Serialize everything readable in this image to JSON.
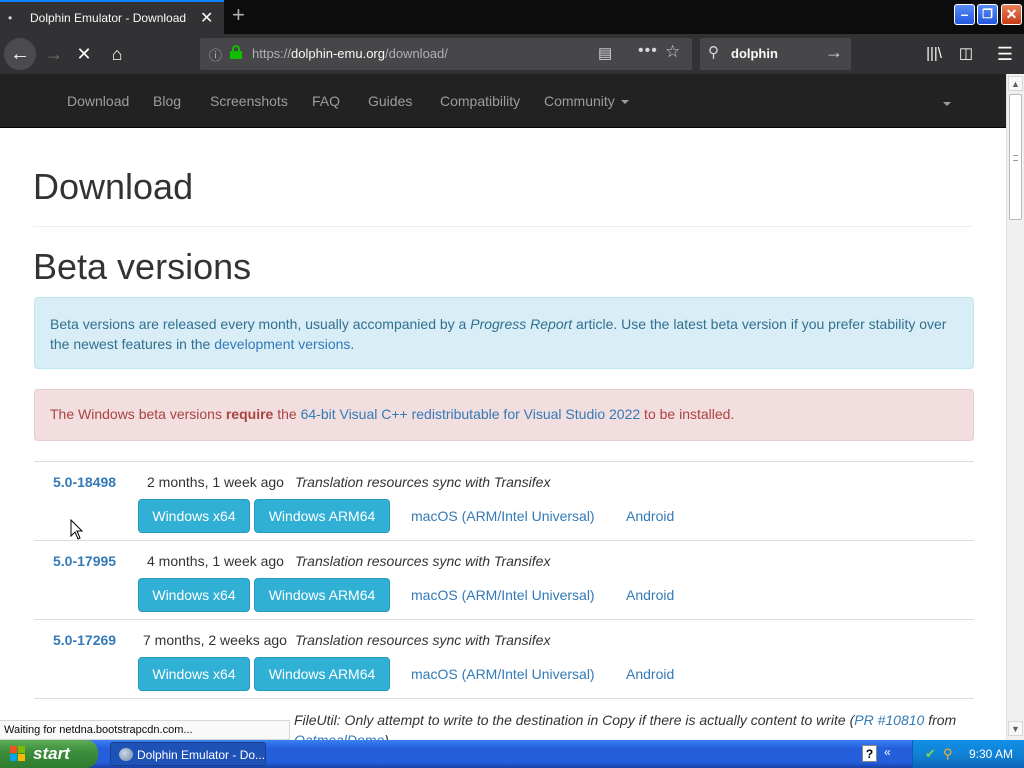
{
  "window": {
    "tab_title": "Dolphin Emulator - Download",
    "tab_bullet": "•",
    "new_tab_glyph": "+",
    "min_glyph": "–",
    "max_glyph": "❐",
    "close_glyph": "✕"
  },
  "toolbar": {
    "back_glyph": "←",
    "forward_glyph": "→",
    "stop_glyph": "✕",
    "home_glyph": "⌂",
    "info_glyph": "ⓘ",
    "url_scheme": "https://",
    "url_host": "dolphin-emu.org",
    "url_path": "/download/",
    "reader_glyph": "▤",
    "more_glyph": "•••",
    "star_glyph": "☆",
    "search_glyph": "⚲",
    "search_value": "dolphin",
    "search_go_glyph": "→",
    "library_glyph": "|||\\",
    "sidebar_glyph": "◫",
    "menu_glyph": "☰"
  },
  "site_nav": {
    "items": [
      "Download",
      "Blog",
      "Screenshots",
      "FAQ",
      "Guides",
      "Compatibility"
    ],
    "community": "Community"
  },
  "page": {
    "title": "Download",
    "beta_heading": "Beta versions",
    "info_alert": {
      "pre": "Beta versions are released every month, usually accompanied by a ",
      "emph": "Progress Report",
      "mid": " article. Use the latest beta version if you prefer stability over the newest features in the ",
      "link": "development versions",
      "post": "."
    },
    "danger_alert": {
      "pre": "The Windows beta versions ",
      "strong": "require",
      "mid": " the ",
      "link": "64-bit Visual C++ redistributable for Visual Studio 2022",
      "post": " to be installed."
    },
    "builds": [
      {
        "version": "5.0-18498",
        "age": "2 months, 1 week ago",
        "message": "Translation resources sync with Transifex",
        "win_x64": "Windows x64",
        "win_arm": "Windows ARM64",
        "mac": "macOS (ARM/Intel Universal)",
        "android": "Android"
      },
      {
        "version": "5.0-17995",
        "age": "4 months, 1 week ago",
        "message": "Translation resources sync with Transifex",
        "win_x64": "Windows x64",
        "win_arm": "Windows ARM64",
        "mac": "macOS (ARM/Intel Universal)",
        "android": "Android"
      },
      {
        "version": "5.0-17269",
        "age": "7 months, 2 weeks ago",
        "message": "Translation resources sync with Transifex",
        "win_x64": "Windows x64",
        "win_arm": "Windows ARM64",
        "mac": "macOS (ARM/Intel Universal)",
        "android": "Android"
      }
    ],
    "partial_row": {
      "line1_pre": "FileUtil: Only attempt to write to the destination in Copy if there is actually content to write (",
      "line1_link": "PR #10810",
      "line1_post": " from",
      "line2_link": "OatmealDome",
      "line2_post": ")"
    }
  },
  "status": {
    "text": "Waiting for netdna.bootstrapcdn.com..."
  },
  "scrollbar": {
    "up_glyph": "▲",
    "down_glyph": "▼"
  },
  "taskbar": {
    "start_label": "start",
    "task_label": "Dolphin Emulator - Do...",
    "help_glyph": "?",
    "tray_chevron": "«",
    "tray_icon1": "✔",
    "tray_icon2": "⚲",
    "clock": "9:30 AM"
  },
  "colors": {
    "tab_accent": "#0a84ff",
    "link": "#337ab7",
    "info_button": "#31b0d5",
    "info_alert_bg": "#d9edf7",
    "danger_alert_bg": "#f2dede",
    "navbar_bg": "#222222"
  }
}
